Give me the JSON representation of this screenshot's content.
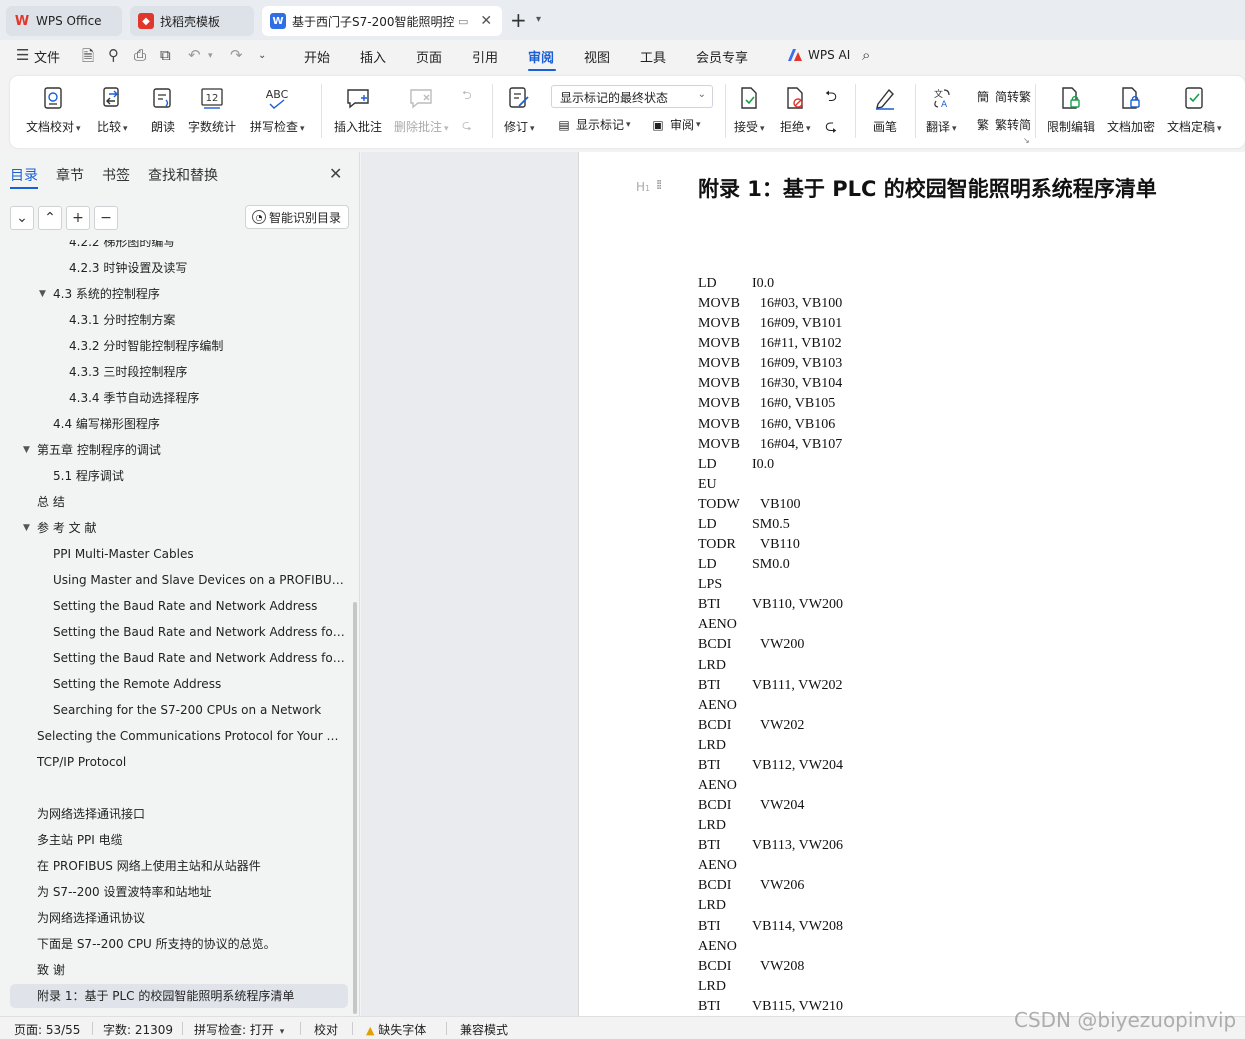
{
  "tabs": [
    {
      "label": "WPS Office"
    },
    {
      "label": "找稻壳模板"
    },
    {
      "label": "基于西门子S7-200智能照明控"
    }
  ],
  "menu": {
    "file": "文件",
    "items": [
      "开始",
      "插入",
      "页面",
      "引用",
      "审阅",
      "视图",
      "工具",
      "会员专享"
    ],
    "active": "审阅",
    "wps_ai": "WPS AI"
  },
  "ribbon": {
    "doc_proofread": "文档校对",
    "compare": "比较",
    "read_aloud": "朗读",
    "word_count": "字数统计",
    "spell_check": "拼写检查",
    "insert_comment": "插入批注",
    "delete_comment": "删除批注",
    "revise": "修订",
    "show_markup_state": "显示标记的最终状态",
    "show_markup": "显示标记",
    "review": "审阅",
    "accept": "接受",
    "reject": "拒绝",
    "ink": "画笔",
    "translate": "翻译",
    "to_traditional": "简转繁",
    "to_simplified": "繁转简",
    "restrict_edit": "限制编辑",
    "encrypt": "文档加密",
    "finalize": "文档定稿",
    "spell_icon_text": "ABC",
    "count_icon_text": "12"
  },
  "nav": {
    "tabs": [
      "目录",
      "章节",
      "书签",
      "查找和替换"
    ],
    "smart_button": "智能识别目录",
    "toc": [
      {
        "label": "4.2.2  梯形图的编写",
        "level": 3
      },
      {
        "label": "4.2.3  时钟设置及读写",
        "level": 3
      },
      {
        "label": "4.3  系统的控制程序",
        "level": 2,
        "expanded": true
      },
      {
        "label": "4.3.1  分时控制方案",
        "level": 3
      },
      {
        "label": "4.3.2  分时智能控制程序编制",
        "level": 3
      },
      {
        "label": "4.3.3  三时段控制程序",
        "level": 3
      },
      {
        "label": "4.3.4  季节自动选择程序",
        "level": 3
      },
      {
        "label": "4.4  编写梯形图程序",
        "level": 2
      },
      {
        "label": "第五章  控制程序的调试",
        "level": 1,
        "expanded": true
      },
      {
        "label": "5.1  程序调试",
        "level": 2
      },
      {
        "label": "总    结",
        "level": 1
      },
      {
        "label": "参 考 文 献",
        "level": 1,
        "expanded": true
      },
      {
        "label": "PPI Multi-Master Cables",
        "level": 2
      },
      {
        "label": "Using Master and Slave Devices on a PROFIBUS ...",
        "level": 2
      },
      {
        "label": "Setting the Baud Rate and Network Address",
        "level": 2
      },
      {
        "label": "Setting the Baud Rate and Network Address for ...",
        "level": 2
      },
      {
        "label": "Setting the Baud Rate and Network Address for ...",
        "level": 2
      },
      {
        "label": "Setting the Remote Address",
        "level": 2
      },
      {
        "label": "Searching for the S7-200 CPUs on a Network",
        "level": 2
      },
      {
        "label": "Selecting the Communications Protocol for Your N...",
        "level": 1
      },
      {
        "label": "TCP/IP Protocol",
        "level": 1
      },
      {
        "label": "",
        "level": 1
      },
      {
        "label": "为网络选择通讯接口",
        "level": 1
      },
      {
        "label": "多主站 PPI 电缆",
        "level": 1
      },
      {
        "label": "在 PROFIBUS 网络上使用主站和从站器件",
        "level": 1
      },
      {
        "label": "为 S7--200 设置波特率和站地址",
        "level": 1
      },
      {
        "label": "为网络选择通讯协议",
        "level": 1
      },
      {
        "label": "下面是 S7--200 CPU 所支持的协议的总览。",
        "level": 1
      },
      {
        "label": "致    谢",
        "level": 1
      },
      {
        "label": "附录 1：基于 PLC 的校园智能照明系统程序清单",
        "level": 1,
        "selected": true
      }
    ]
  },
  "document": {
    "heading": "附录 1：基于 PLC 的校园智能照明系统程序清单",
    "heading_marker": "H",
    "code": [
      {
        "op": "LD",
        "arg": "I0.0"
      },
      {
        "op": "MOVB",
        "arg": "16#03, VB100"
      },
      {
        "op": "MOVB",
        "arg": "16#09, VB101"
      },
      {
        "op": "MOVB",
        "arg": "16#11, VB102"
      },
      {
        "op": "MOVB",
        "arg": "16#09, VB103"
      },
      {
        "op": "MOVB",
        "arg": "16#30, VB104"
      },
      {
        "op": "MOVB",
        "arg": "16#0, VB105"
      },
      {
        "op": "MOVB",
        "arg": "16#0, VB106"
      },
      {
        "op": "MOVB",
        "arg": "16#04, VB107"
      },
      {
        "op": "LD",
        "arg": "I0.0"
      },
      {
        "op": "EU",
        "arg": ""
      },
      {
        "op": "TODW",
        "arg": "VB100"
      },
      {
        "op": "LD",
        "arg": "SM0.5"
      },
      {
        "op": "TODR",
        "arg": "VB110"
      },
      {
        "op": "LD",
        "arg": "SM0.0"
      },
      {
        "op": "LPS",
        "arg": ""
      },
      {
        "op": "BTI",
        "arg": "VB110, VW200"
      },
      {
        "op": "AENO",
        "arg": ""
      },
      {
        "op": "BCDI",
        "arg": "VW200"
      },
      {
        "op": "LRD",
        "arg": ""
      },
      {
        "op": "BTI",
        "arg": "VB111, VW202"
      },
      {
        "op": "AENO",
        "arg": ""
      },
      {
        "op": "BCDI",
        "arg": "VW202"
      },
      {
        "op": "LRD",
        "arg": ""
      },
      {
        "op": "BTI",
        "arg": "VB112, VW204"
      },
      {
        "op": "AENO",
        "arg": ""
      },
      {
        "op": "BCDI",
        "arg": "VW204"
      },
      {
        "op": "LRD",
        "arg": ""
      },
      {
        "op": "BTI",
        "arg": "VB113, VW206"
      },
      {
        "op": "AENO",
        "arg": ""
      },
      {
        "op": "BCDI",
        "arg": "VW206"
      },
      {
        "op": "LRD",
        "arg": ""
      },
      {
        "op": "BTI",
        "arg": "VB114, VW208"
      },
      {
        "op": "AENO",
        "arg": ""
      },
      {
        "op": "BCDI",
        "arg": "VW208"
      },
      {
        "op": "LRD",
        "arg": ""
      },
      {
        "op": "BTI",
        "arg": "VB115, VW210"
      }
    ]
  },
  "status": {
    "page": "页面: 53/55",
    "words": "字数: 21309",
    "spell": "拼写检查: 打开",
    "proof": "校对",
    "missing_font": "缺失字体",
    "compat": "兼容模式"
  },
  "watermark": "CSDN @biyezuopinvip",
  "colors": {
    "accent": "#1b5fd6",
    "wps_red": "#e0362c",
    "word_blue": "#2f6fe6"
  }
}
